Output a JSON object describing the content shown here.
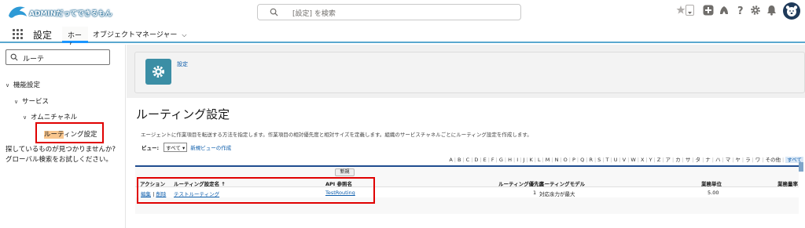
{
  "header": {
    "logo_text": "ADMINだってできるもん",
    "search_placeholder": "[設定] を検索",
    "icons": [
      "favorite-star-icon",
      "favorites-dropdown-icon",
      "plus-icon",
      "trailhead-icon",
      "help-icon",
      "gear-icon",
      "bell-icon",
      "avatar"
    ]
  },
  "nav": {
    "app_name": "設定",
    "tabs": [
      {
        "label": "ホーム",
        "active": true
      },
      {
        "label": "オブジェクトマネージャー",
        "active": false
      }
    ]
  },
  "sidebar": {
    "quick_find_value": "ルーテ",
    "tree": [
      {
        "label": "機能設定"
      },
      {
        "label": "サービス"
      },
      {
        "label": "オムニチャネル"
      }
    ],
    "selected_item": {
      "highlight": "ルーテ",
      "rest": "ィング設定"
    },
    "not_found_line1": "探しているものが見つかりませんか?",
    "not_found_line2": "グローバル検索をお試しください。"
  },
  "page": {
    "breadcrumb": "設定",
    "title": "ルーティング設定",
    "description": "エージェントに作業項目を転送する方法を指定します。作業項目の相対優先度と相対サイズを定義します。組織のサービスチャネルごとにルーティング設定を作成します。",
    "view_label": "ビュー:",
    "view_value": "すべて",
    "create_view": "新規ビューの作成",
    "alphabet": [
      "A",
      "B",
      "C",
      "D",
      "E",
      "F",
      "G",
      "H",
      "I",
      "J",
      "K",
      "L",
      "M",
      "N",
      "O",
      "P",
      "Q",
      "R",
      "S",
      "T",
      "U",
      "V",
      "W",
      "X",
      "Y",
      "Z",
      "ア",
      "カ",
      "サ",
      "タ",
      "ナ",
      "ハ",
      "マ",
      "ヤ",
      "ラ",
      "ワ",
      "その他"
    ],
    "alphabet_all": "すべて",
    "new_button": "新規"
  },
  "table": {
    "columns": [
      "アクション",
      "ルーティング設定名 ↑",
      "API 参照名",
      "ルーティング優先度",
      "ルーティングモデル",
      "業務単位",
      "業務量率"
    ],
    "rows": [
      {
        "edit": "編集",
        "delete": "削除",
        "name": "テストルーティング",
        "api_name": "TestRouting",
        "priority": "1",
        "model": "対応余力が最大",
        "units": "5.00",
        "percent": ""
      }
    ]
  },
  "colors": {
    "accent": "#1b96ff",
    "nav_border": "#5aa8cf",
    "gear_tile": "#3b8ea5",
    "link": "#0b5cab",
    "annotation": "#e00000"
  }
}
